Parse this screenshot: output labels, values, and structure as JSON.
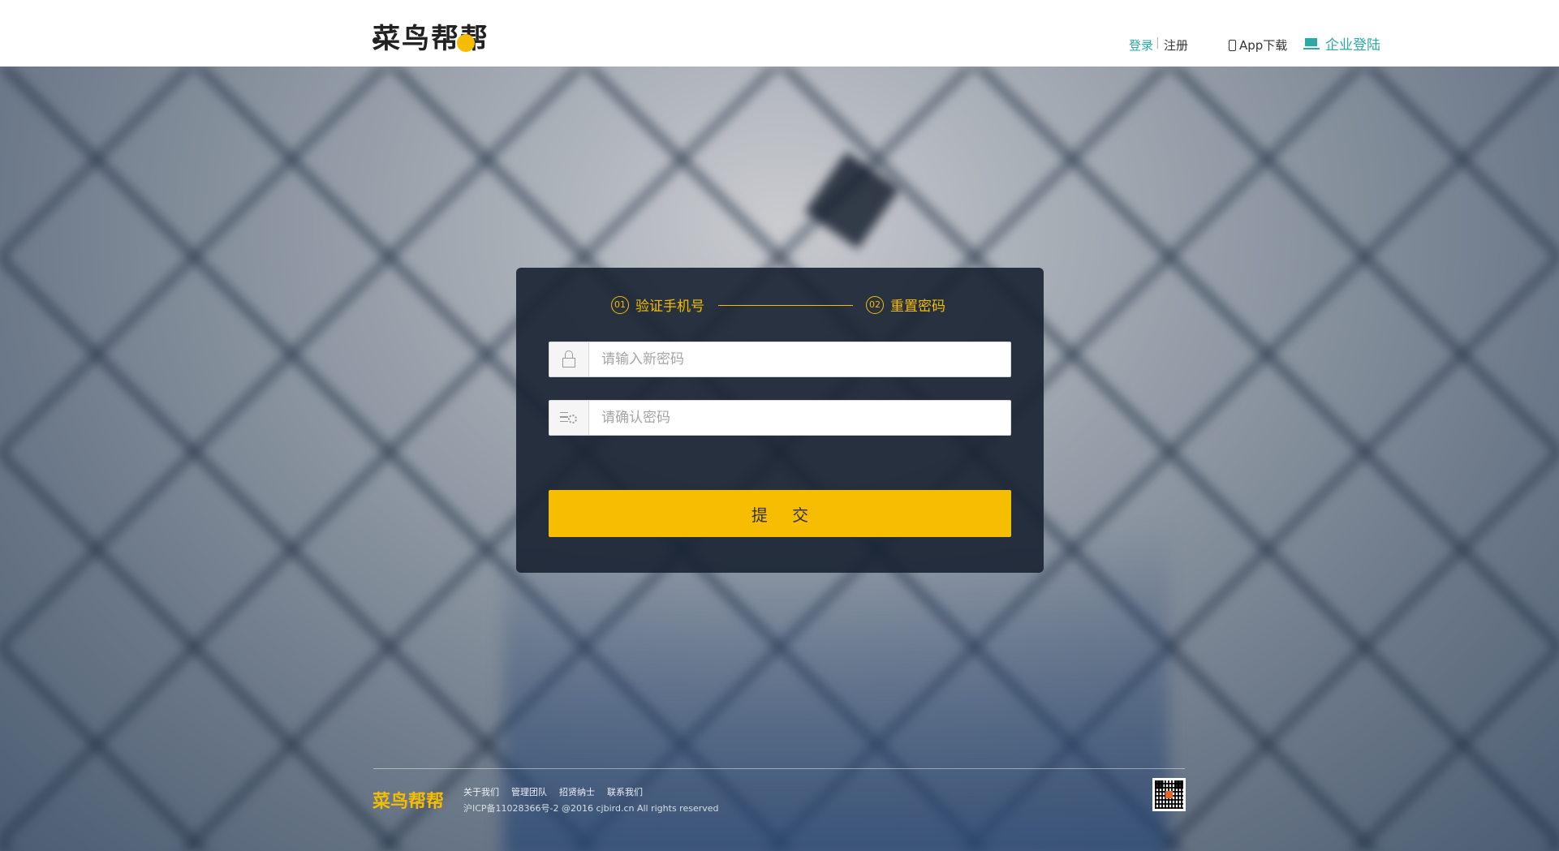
{
  "header": {
    "logo_text": "菜鸟帮帮",
    "login": "登录",
    "separator": "|",
    "register": "注册",
    "app_download": "App下载",
    "enterprise_login": "企业登陆"
  },
  "steps": [
    {
      "num": "01",
      "label": "验证手机号"
    },
    {
      "num": "02",
      "label": "重置密码"
    }
  ],
  "form": {
    "new_password_placeholder": "请输入新密码",
    "confirm_password_placeholder": "请确认密码",
    "submit_label": "提 交"
  },
  "footer": {
    "logo_text": "菜鸟帮帮",
    "links": [
      "关于我们",
      "管理团队",
      "招贤纳士",
      "联系我们"
    ],
    "copyright": "沪ICP备11028366号-2 @2016 cjbird.cn All rights reserved"
  },
  "colors": {
    "accent": "#f7bd00",
    "teal": "#2aa9a6",
    "panel": "#182232"
  }
}
